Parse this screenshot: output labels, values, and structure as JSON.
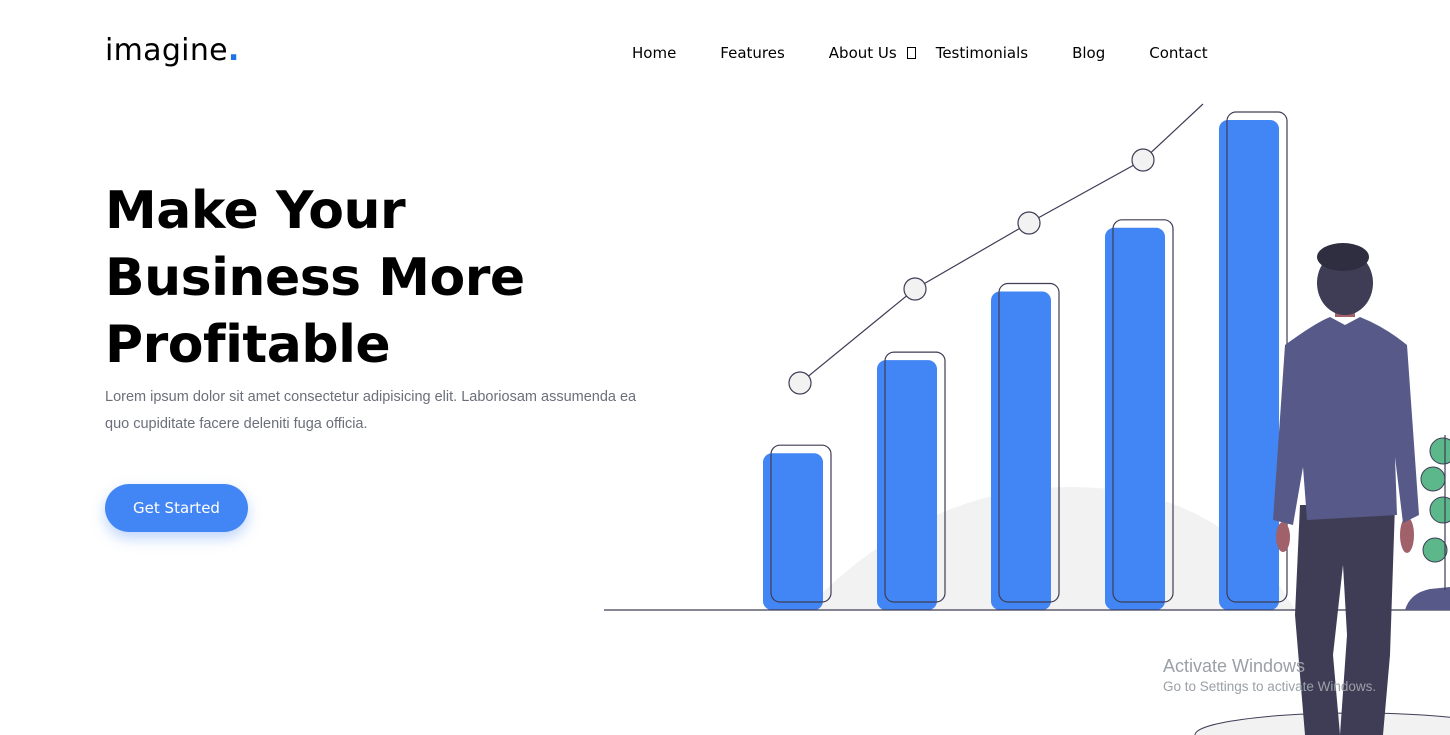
{
  "brand": {
    "name": "imagine",
    "dot": ".",
    "accent": "#1a73e8"
  },
  "nav": {
    "items": [
      {
        "label": "Home"
      },
      {
        "label": "Features"
      },
      {
        "label": "About Us",
        "has_dropdown": true,
        "dropdown_icon": "chevron-down-icon"
      },
      {
        "label": "Testimonials"
      },
      {
        "label": "Blog"
      },
      {
        "label": "Contact"
      }
    ]
  },
  "hero": {
    "title_line1": "Make Your",
    "title_line2": "Business More",
    "title_line3": "Profitable",
    "subtitle": "Lorem ipsum dolor sit amet consectetur adipisicing elit. Laboriosam assumenda ea quo cupiditate facere deleniti fuga officia.",
    "cta_label": "Get Started",
    "cta_color": "#4285f4"
  },
  "illustration": {
    "subject": "growth-bar-chart-with-businessman",
    "bar_color": "#4285f4",
    "bar_levels": [
      0.32,
      0.51,
      0.65,
      0.78,
      1.0
    ],
    "suit_color": "#575a89"
  },
  "watermark": {
    "line1": "Activate Windows",
    "line2": "Go to Settings to activate Windows."
  }
}
